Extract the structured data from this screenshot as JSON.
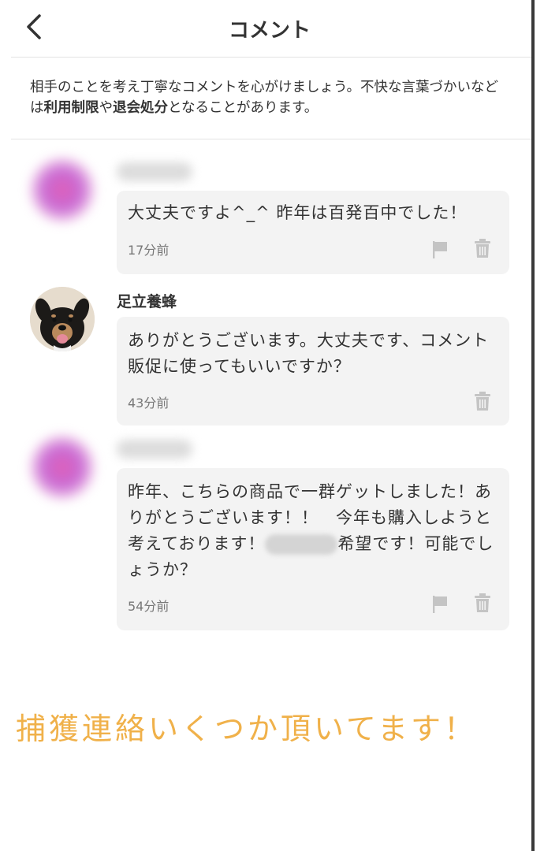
{
  "header": {
    "title": "コメント"
  },
  "notice": {
    "part1": "相手のことを考え丁寧なコメントを心がけましょう。不快な言葉づかいなどは",
    "bold1": "利用制限",
    "part2": "や",
    "bold2": "退会処分",
    "part3": "となることがあります。"
  },
  "comments": [
    {
      "text": "大丈夫ですよ^_^ 昨年は百発百中でした！",
      "time": "17分前"
    },
    {
      "user": "足立養蜂",
      "text": "ありがとうございます。大丈夫です、コメント販促に使ってもいいですか？",
      "time": "43分前"
    },
    {
      "text_before": "昨年、こちらの商品で一群ゲットしました！ありがとうございます！！　今年も購入しようと考えております！",
      "text_after": "希望です！可能でしょうか？",
      "time": "54分前"
    }
  ],
  "footer": {
    "note": "捕獲連絡いくつか頂いてます！"
  },
  "colors": {
    "footer_note": "#f0b14a",
    "bubble": "#f3f3f3"
  }
}
